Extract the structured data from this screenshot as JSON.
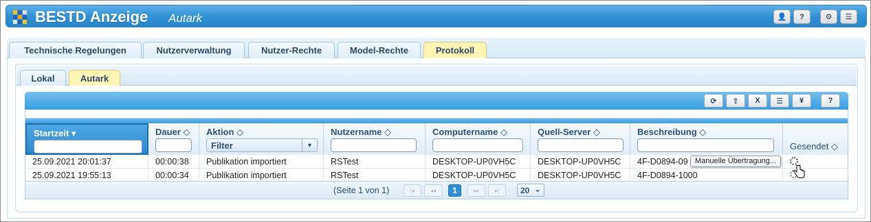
{
  "header": {
    "title": "BESTD Anzeige",
    "subtitle": "Autark",
    "buttons": [
      {
        "icon": "user-icon",
        "glyph": "👤"
      },
      {
        "icon": "help-icon",
        "glyph": "?"
      },
      {
        "icon": "gear-icon",
        "glyph": "⚙"
      },
      {
        "icon": "menu-icon",
        "glyph": "☰"
      }
    ],
    "logo_colors": [
      "#f4c21a",
      "#2a62b8",
      "#e0e0e0",
      "#e0a31a"
    ]
  },
  "main_tabs": [
    {
      "label": "Technische Regelungen",
      "active": false
    },
    {
      "label": "Nutzerverwaltung",
      "active": false
    },
    {
      "label": "Nutzer-Rechte",
      "active": false
    },
    {
      "label": "Model-Rechte",
      "active": false
    },
    {
      "label": "Protokoll",
      "active": true
    }
  ],
  "sub_tabs": [
    {
      "label": "Lokal",
      "active": false
    },
    {
      "label": "Autark",
      "active": true
    }
  ],
  "toolbar": {
    "buttons": [
      {
        "icon": "refresh-icon",
        "glyph": "⟳"
      },
      {
        "icon": "upload-icon",
        "glyph": "⇪"
      },
      {
        "icon": "export-excel-icon",
        "glyph": "X"
      },
      {
        "icon": "list-icon",
        "glyph": "☰"
      },
      {
        "icon": "yen-icon",
        "glyph": "¥"
      },
      {
        "icon": "help-icon",
        "glyph": "?"
      }
    ]
  },
  "grid": {
    "columns": [
      {
        "label": "Startzeit ▾",
        "filter": "input",
        "sorted": true
      },
      {
        "label": "Dauer ◇",
        "filter": "input"
      },
      {
        "label": "Aktion ◇",
        "filter": "select",
        "filter_value": "Filter"
      },
      {
        "label": "Nutzername ◇",
        "filter": "input"
      },
      {
        "label": "Computername ◇",
        "filter": "input"
      },
      {
        "label": "Quell-Server ◇",
        "filter": "input"
      },
      {
        "label": "Beschreibung ◇",
        "filter": "input"
      },
      {
        "label": "Gesendet ◇",
        "filter": "none"
      }
    ],
    "rows": [
      [
        "25.09.2021 20:01:37",
        "00:00:38",
        "Publikation importiert",
        "RSTest",
        "DESKTOP-UP0VH5C",
        "DESKTOP-UP0VH5C",
        "4F-D0894-09",
        ""
      ],
      [
        "25.09.2021 19:55:13",
        "00:00:34",
        "Publikation importiert",
        "RSTest",
        "DESKTOP-UP0VH5C",
        "DESKTOP-UP0VH5C",
        "4F-D0894-1000",
        ""
      ]
    ],
    "tooltip": "Manuelle Übertragung..."
  },
  "pager": {
    "info": "(Seite 1 von 1)",
    "current_page": "1",
    "page_size": "20",
    "first_glyph": "|◂",
    "prev_glyph": "◂◂",
    "next_glyph": "▸▸",
    "last_glyph": "▸|",
    "size_arrow": "⌄"
  }
}
